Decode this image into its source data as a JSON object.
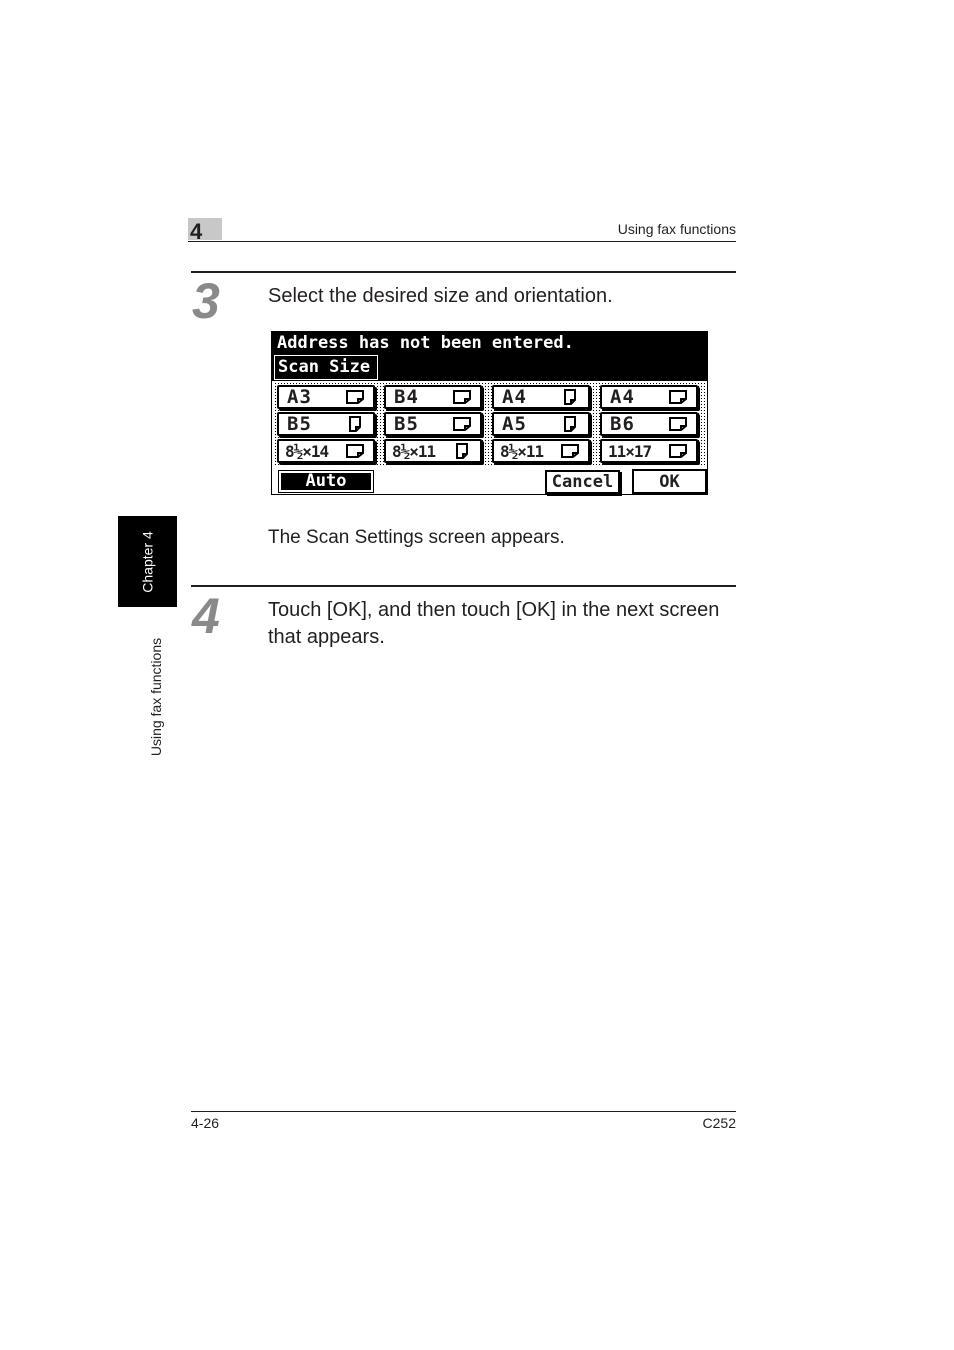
{
  "header": {
    "chapter_number": "4",
    "section_title": "Using fax functions"
  },
  "side_tab": {
    "chapter_label": "Chapter 4",
    "section_label": "Using fax functions"
  },
  "steps": [
    {
      "number": "3",
      "instruction": "Select the desired size and orientation.",
      "note": "The Scan Settings screen appears."
    },
    {
      "number": "4",
      "instruction": "Touch [OK], and then touch [OK] in the next screen that appears."
    }
  ],
  "screen": {
    "message": "Address has not been entered.",
    "tab_label": "Scan Size",
    "sizes": [
      {
        "label": "A3",
        "orientation": "landscape-icon"
      },
      {
        "label": "B4",
        "orientation": "landscape-icon"
      },
      {
        "label": "A4",
        "orientation": "portrait-icon"
      },
      {
        "label": "A4",
        "orientation": "landscape-icon"
      },
      {
        "label": "B5",
        "orientation": "portrait-icon"
      },
      {
        "label": "B5",
        "orientation": "landscape-icon"
      },
      {
        "label": "A5",
        "orientation": "portrait-icon"
      },
      {
        "label": "B6",
        "orientation": "landscape-icon"
      },
      {
        "label": "8½×14",
        "orientation": "landscape-icon"
      },
      {
        "label": "8½×11",
        "orientation": "portrait-icon"
      },
      {
        "label": "8½×11",
        "orientation": "landscape-icon"
      },
      {
        "label": "11×17",
        "orientation": "landscape-icon"
      }
    ],
    "auto_label": "Auto",
    "cancel_label": "Cancel",
    "ok_label": "OK"
  },
  "footer": {
    "page_number": "4-26",
    "model": "C252"
  }
}
